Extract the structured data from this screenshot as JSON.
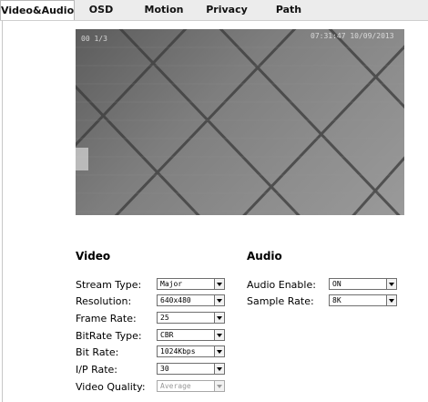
{
  "tabs": [
    {
      "label": "Video&Audio",
      "active": true
    },
    {
      "label": "OSD"
    },
    {
      "label": "Motion"
    },
    {
      "label": "Privacy"
    },
    {
      "label": "Path"
    }
  ],
  "preview": {
    "overlay_left": "00 1/3",
    "overlay_right": "07:31:47 10/09/2013"
  },
  "video": {
    "title": "Video",
    "fields": [
      {
        "label": "Stream Type:",
        "value": "Major"
      },
      {
        "label": "Resolution:",
        "value": "640x480"
      },
      {
        "label": "Frame Rate:",
        "value": "25"
      },
      {
        "label": "BitRate Type:",
        "value": "CBR"
      },
      {
        "label": "Bit Rate:",
        "value": "1024Kbps"
      },
      {
        "label": "I/P Rate:",
        "value": "30"
      },
      {
        "label": "Video Quality:",
        "value": "Average",
        "disabled": true
      }
    ]
  },
  "audio": {
    "title": "Audio",
    "fields": [
      {
        "label": "Audio Enable:",
        "value": "ON"
      },
      {
        "label": "Sample Rate:",
        "value": "8K"
      }
    ]
  }
}
